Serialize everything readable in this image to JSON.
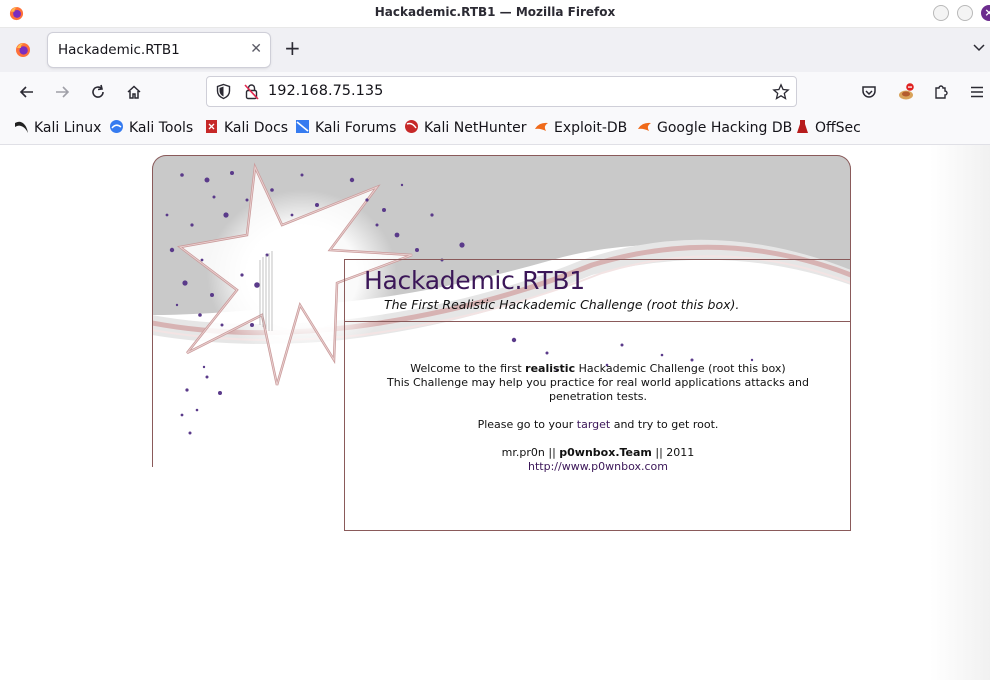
{
  "window": {
    "title": "Hackademic.RTB1 — Mozilla Firefox",
    "close_glyph": "×"
  },
  "tabs": [
    {
      "label": "Hackademic.RTB1",
      "close": "✕"
    }
  ],
  "new_tab_glyph": "+",
  "address_bar": {
    "url": "192.168.75.135"
  },
  "bookmarks": [
    {
      "label": "Kali Linux",
      "icon": "kali-dragon-icon"
    },
    {
      "label": "Kali Tools",
      "icon": "kali-tools-icon"
    },
    {
      "label": "Kali Docs",
      "icon": "kali-docs-icon"
    },
    {
      "label": "Kali Forums",
      "icon": "kali-forums-icon"
    },
    {
      "label": "Kali NetHunter",
      "icon": "nethunter-icon"
    },
    {
      "label": "Exploit-DB",
      "icon": "exploit-db-icon"
    },
    {
      "label": "Google Hacking DB",
      "icon": "ghdb-icon"
    },
    {
      "label": "OffSec",
      "icon": "offsec-icon"
    }
  ],
  "page": {
    "title": "Hackademic.RTB1",
    "subtitle": "The First Realistic Hackademic Challenge (root this box).",
    "welcome_prefix": "Welcome to the first ",
    "welcome_bold": "realistic",
    "welcome_suffix": " Hackademic Challenge (root this box)",
    "line2": "This Challenge may help you practice for real world applications attacks and penetration tests.",
    "goto_prefix": "Please go to your ",
    "goto_link": "target",
    "goto_suffix": " and try to get root.",
    "credit_prefix": "mr.pr0n || ",
    "credit_bold": "p0wnbox.Team",
    "credit_suffix": " || 2011",
    "site_link": "http://www.p0wnbox.com"
  },
  "colors": {
    "accent": "#3b1658",
    "border": "#8a5a5a",
    "star_stroke": "#c99a9a",
    "banner_gray": "#c8c8c8",
    "dots": "#5a3a8a"
  }
}
